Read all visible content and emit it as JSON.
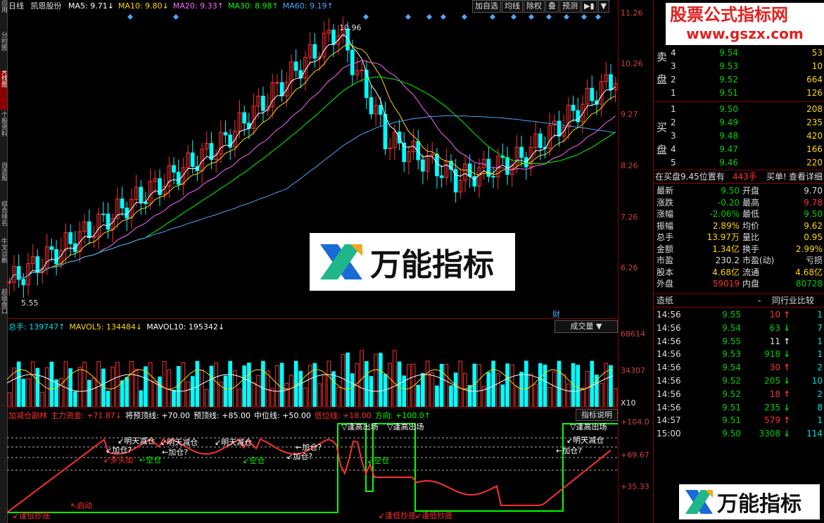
{
  "left_tabs": [
    "应用",
    "分时图",
    "K线图",
    "个股资料",
    "自选股",
    "综合排名",
    "牛叉诊断",
    "超级盘口"
  ],
  "title": {
    "period": "日线",
    "stock": "凯恩股份",
    "ma": [
      {
        "label": "MA5: 9.71↓",
        "color": "#ffffff"
      },
      {
        "label": "MA10: 9.80↓",
        "color": "#ffd700"
      },
      {
        "label": "MA20: 9.33↑",
        "color": "#ff66ff"
      },
      {
        "label": "MA30: 8.98↑",
        "color": "#00ff00"
      },
      {
        "label": "MA60: 9.19↑",
        "color": "#4aa8ff"
      }
    ]
  },
  "top_buttons": [
    "加自选",
    "均线",
    "除权",
    "叠",
    "预测",
    "▶▮",
    "▼"
  ],
  "price_axis": [
    "11.26",
    "10.26",
    "9.27",
    "8.26",
    "7.26",
    "6.26"
  ],
  "annotations": {
    "high": "10.96",
    "low": "5.55",
    "cai": "财"
  },
  "volume": {
    "header": [
      {
        "label": "总手: 139747↑",
        "color": "#00e0e0"
      },
      {
        "label": "MAVOL5: 134484↓",
        "color": "#ffd700"
      },
      {
        "label": "MAVOL10: 195342↓",
        "color": "#ffffff"
      }
    ],
    "select": "成交量",
    "axis": [
      "68614",
      "34307"
    ],
    "unit": "X10"
  },
  "indicator": {
    "header": [
      {
        "label": "加减仓副林",
        "color": "#ff3030"
      },
      {
        "label": "主力资金: +71.87↓",
        "color": "#ff3030"
      },
      {
        "label": "将预顶线: +70.00",
        "color": "#ffffff"
      },
      {
        "label": "预顶线: +85.00",
        "color": "#ffffff"
      },
      {
        "label": "中位线: +50.00",
        "color": "#ffffff"
      },
      {
        "label": "低位线: +18.00",
        "color": "#ff3030"
      },
      {
        "label": "方向: +100.0↑",
        "color": "#00ff00"
      }
    ],
    "button": "指标说明",
    "axis": [
      "+104.0",
      "+69.67",
      "+35.33"
    ],
    "labels": [
      {
        "t": "↖启动",
        "c": "#ff3030"
      },
      {
        "t": "↙逢低抄底",
        "c": "#ff3030"
      },
      {
        "t": "↙多头加",
        "c": "#ff3030"
      },
      {
        "t": "↙加仓?",
        "c": "#ffffff"
      },
      {
        "t": "↙明天减仓",
        "c": "#ffffff"
      },
      {
        "t": "↙明天减仓",
        "c": "#ffffff"
      },
      {
        "t": "←空仓",
        "c": "#00ff00"
      },
      {
        "t": "←加仓?",
        "c": "#ffffff"
      },
      {
        "t": "↙明天减仓",
        "c": "#ffffff"
      },
      {
        "t": "↙空仓",
        "c": "#00ff00"
      },
      {
        "t": "↙加仓?",
        "c": "#ffffff"
      },
      {
        "t": "←加仓?",
        "c": "#ffffff"
      },
      {
        "t": "▽逢高出场",
        "c": "#ffffff"
      },
      {
        "t": "▽逢高出场",
        "c": "#ffffff"
      },
      {
        "t": "↙空仓",
        "c": "#00ff00"
      },
      {
        "t": "↙逢低抄底",
        "c": "#ff3030"
      },
      {
        "t": "↙逢低抄底",
        "c": "#ff3030"
      },
      {
        "t": "▽逢高出场",
        "c": "#ffffff"
      },
      {
        "t": "↙明天减仓",
        "c": "#ffffff"
      },
      {
        "t": "←加仓?",
        "c": "#ffffff"
      }
    ]
  },
  "watermark_center": "万能指标",
  "watermark_corner": "万能指标",
  "watermark_site": {
    "name": "股票公式指标网",
    "url": "www.gszx.com"
  },
  "orderbook": {
    "sell_label": [
      "卖",
      "盘"
    ],
    "buy_label": [
      "买",
      "盘"
    ],
    "sells": [
      {
        "n": "4",
        "p": "9.54",
        "v": "53"
      },
      {
        "n": "3",
        "p": "9.53",
        "v": "10"
      },
      {
        "n": "2",
        "p": "9.52",
        "v": "664"
      },
      {
        "n": "1",
        "p": "9.51",
        "v": "126"
      }
    ],
    "buys": [
      {
        "n": "1",
        "p": "9.50",
        "v": "208"
      },
      {
        "n": "2",
        "p": "9.49",
        "v": "235"
      },
      {
        "n": "3",
        "p": "9.48",
        "v": "420"
      },
      {
        "n": "4",
        "p": "9.47",
        "v": "166"
      },
      {
        "n": "5",
        "p": "9.46",
        "v": "220"
      }
    ],
    "info": {
      "left": "在买盘9.45位置有",
      "mid": "443手",
      "right": "买单!",
      "link": "查看详细"
    }
  },
  "quote": [
    {
      "k1": "最新",
      "v1": "9.50",
      "c1": "gr",
      "k2": "开盘",
      "v2": "9.70",
      "c2": "wh"
    },
    {
      "k1": "涨跌",
      "v1": "-0.20",
      "c1": "gr",
      "k2": "最高",
      "v2": "9.78",
      "c2": "rd"
    },
    {
      "k1": "涨幅",
      "v1": "-2.06%",
      "c1": "gr",
      "k2": "最低",
      "v2": "9.50",
      "c2": "gr"
    },
    {
      "k1": "振幅",
      "v1": "2.89%",
      "c1": "yl",
      "k2": "均价",
      "v2": "9.62",
      "c2": "yl"
    },
    {
      "k1": "总手",
      "v1": "13.97万",
      "c1": "yl",
      "k2": "量比",
      "v2": "0.95",
      "c2": "yl"
    },
    {
      "k1": "金额",
      "v1": "1.34亿",
      "c1": "yl",
      "k2": "换手",
      "v2": "2.99%",
      "c2": "yl"
    },
    {
      "k1": "市盈",
      "v1": "230.2",
      "c1": "wh",
      "k2": "市盈(动)",
      "v2": "亏损",
      "c2": "wh"
    },
    {
      "k1": "股本",
      "v1": "4.68亿",
      "c1": "yl",
      "k2": "流通",
      "v2": "4.68亿",
      "c2": "yl"
    },
    {
      "k1": "外盘",
      "v1": "59019",
      "c1": "rd",
      "k2": "内盘",
      "v2": "80728",
      "c2": "gr"
    }
  ],
  "industry": {
    "left": "造纸",
    "dash": "-",
    "right": "同行业比较"
  },
  "ticks": [
    {
      "t": "14:56",
      "p": "9.55",
      "v": "10",
      "d": "up",
      "n": "1"
    },
    {
      "t": "14:56",
      "p": "9.54",
      "v": "63",
      "d": "down",
      "n": "7"
    },
    {
      "t": "14:56",
      "p": "9.55",
      "v": "11",
      "d": "flat",
      "n": "1"
    },
    {
      "t": "14:56",
      "p": "9.53",
      "v": "918",
      "d": "down",
      "n": "1"
    },
    {
      "t": "14:56",
      "p": "9.54",
      "v": "30",
      "d": "up",
      "n": "2"
    },
    {
      "t": "14:56",
      "p": "9.52",
      "v": "205",
      "d": "down",
      "n": "10"
    },
    {
      "t": "14:56",
      "p": "9.52",
      "v": "18",
      "d": "up",
      "n": "2"
    },
    {
      "t": "14:56",
      "p": "9.51",
      "v": "235",
      "d": "down",
      "n": "8"
    },
    {
      "t": "14:57",
      "p": "9.51",
      "v": "579",
      "d": "up",
      "n": "1"
    },
    {
      "t": "15:00",
      "p": "9.50",
      "v": "3308",
      "d": "down",
      "n": "114"
    }
  ]
}
